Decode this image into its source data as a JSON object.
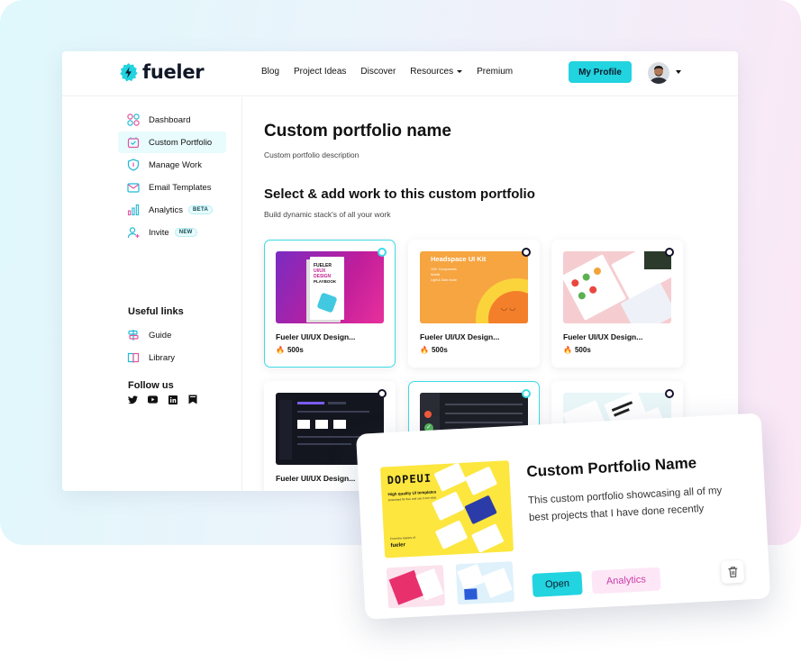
{
  "brand": {
    "name": "fueler",
    "accent": "#22d3e0"
  },
  "nav": {
    "items": [
      "Blog",
      "Project Ideas",
      "Discover",
      "Resources",
      "Premium"
    ],
    "profile_button": "My Profile"
  },
  "sidebar": {
    "items": [
      {
        "label": "Dashboard",
        "icon": "dashboard-icon"
      },
      {
        "label": "Custom Portfolio",
        "icon": "portfolio-icon",
        "active": true
      },
      {
        "label": "Manage Work",
        "icon": "shield-icon"
      },
      {
        "label": "Email Templates",
        "icon": "mail-icon"
      },
      {
        "label": "Analytics",
        "icon": "chart-icon",
        "badge": "BETA"
      },
      {
        "label": "Invite",
        "icon": "user-plus-icon",
        "badge": "NEW"
      }
    ],
    "useful_links_heading": "Useful links",
    "useful_links": [
      {
        "label": "Guide",
        "icon": "guide-icon"
      },
      {
        "label": "Library",
        "icon": "library-icon"
      }
    ],
    "follow_heading": "Follow us",
    "socials": [
      "twitter-icon",
      "youtube-icon",
      "linkedin-icon",
      "bookmark-icon"
    ]
  },
  "main": {
    "title": "Custom portfolio name",
    "description": "Custom portfolio description",
    "section_title": "Select & add work to this custom portfolio",
    "section_sub": "Build dynamic stack's of all your work",
    "cards": [
      {
        "title": "Fueler UI/UX Design...",
        "count": "500s",
        "selected": true,
        "thumb": "book"
      },
      {
        "title": "Fueler UI/UX Design...",
        "count": "500s",
        "selected": false,
        "thumb": "headspace"
      },
      {
        "title": "Fueler UI/UX Design...",
        "count": "500s",
        "selected": false,
        "thumb": "food"
      },
      {
        "title": "Fueler UI/UX Design...",
        "count": "",
        "selected": false,
        "thumb": "dark"
      },
      {
        "title": "",
        "count": "",
        "selected": true,
        "thumb": "dark2"
      },
      {
        "title": "",
        "count": "",
        "selected": false,
        "thumb": "pastel"
      }
    ],
    "thumb_text": {
      "book_l1": "FUELER",
      "book_l2": "UI/UX",
      "book_l3": "DESIGN",
      "book_l4": "PLAYBOOK",
      "headspace_title": "Headspace UI Kit",
      "headspace_l1": "100+ Components",
      "headspace_l2": "Mobile",
      "headspace_l3": "Light & Dark mode"
    }
  },
  "overlay": {
    "title": "Custom Portfolio Name",
    "description": "This custom portfolio showcasing all of my best projects that I have done recently",
    "open_label": "Open",
    "analytics_label": "Analytics",
    "dope_logo": "DOPEUI",
    "dope_tag": "High quality UI templates",
    "dope_sub": "Download for free and use it one-click",
    "dope_from": "From the makers of",
    "dope_brand": "fueler"
  }
}
